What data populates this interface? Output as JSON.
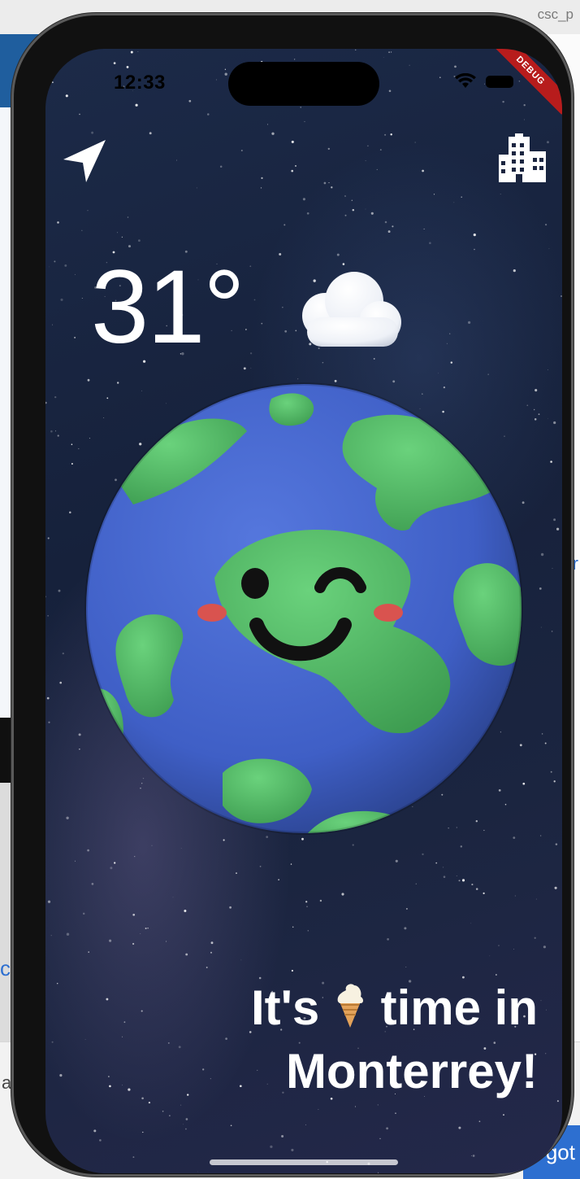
{
  "host": {
    "tab_text": "csc_p",
    "right_edge_text": "r",
    "left_edge_text": "cy",
    "left_bottom_text": "a",
    "action_button": "got"
  },
  "status_bar": {
    "time": "12:33",
    "debug_label": "DEBUG"
  },
  "weather": {
    "temperature": "31°",
    "condition_icon": "cloud-icon"
  },
  "message": {
    "line1_before": "It's",
    "line1_after": "time in",
    "line2": "Monterrey!",
    "emoji": "ice-cream-icon"
  },
  "actions": {
    "location_icon": "navigation-arrow-icon",
    "city_icon": "city-buildings-icon"
  },
  "colors": {
    "sky": "#1b2540",
    "ocean": "#3f5fc6",
    "land": "#4fb862",
    "text": "#ffffff",
    "debug": "#b71c1c"
  }
}
